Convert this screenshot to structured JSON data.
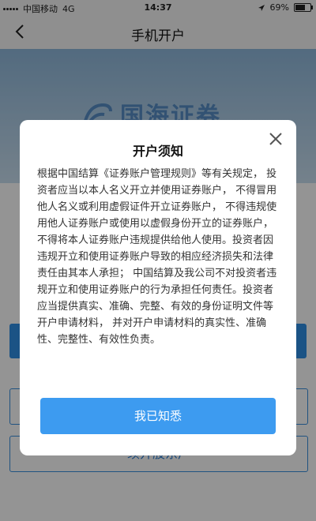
{
  "status_bar": {
    "carrier": "中国移动",
    "network": "4G",
    "time": "14:37",
    "battery_percent": "69%",
    "battery_level": 0.69
  },
  "nav": {
    "title": "手机开户",
    "back_icon": "chevron-left-icon"
  },
  "banner": {
    "brand_text": "国海证券"
  },
  "background": {
    "button_bottom_label": "续开股东户"
  },
  "modal": {
    "title": "开户须知",
    "body": "根据中国结算《证券账户管理规则》等有关规定， 投资者应当以本人名义开立并使用证券账户， 不得冒用他人名义或利用虚假证件开立证券账户， 不得违规使用他人证券账户或使用以虚假身份开立的证券账户， 不得将本人证券账户违规提供给他人使用。投资者因违规开立和使用证券账户导致的相应经济损失和法律责任由其本人承担； 中国结算及我公司不对投资者违规开立和使用证券账户的行为承担任何责任。投资者应当提供真实、准确、完整、有效的身份证明文件等开户申请材料， 并对开户申请材料的真实性、准确性、完整性、有效性负责。",
    "confirm_label": "我已知悉",
    "close_icon": "close-icon"
  },
  "colors": {
    "primary": "#3d9bf0",
    "overlay": "rgba(0,0,0,0.42)"
  }
}
